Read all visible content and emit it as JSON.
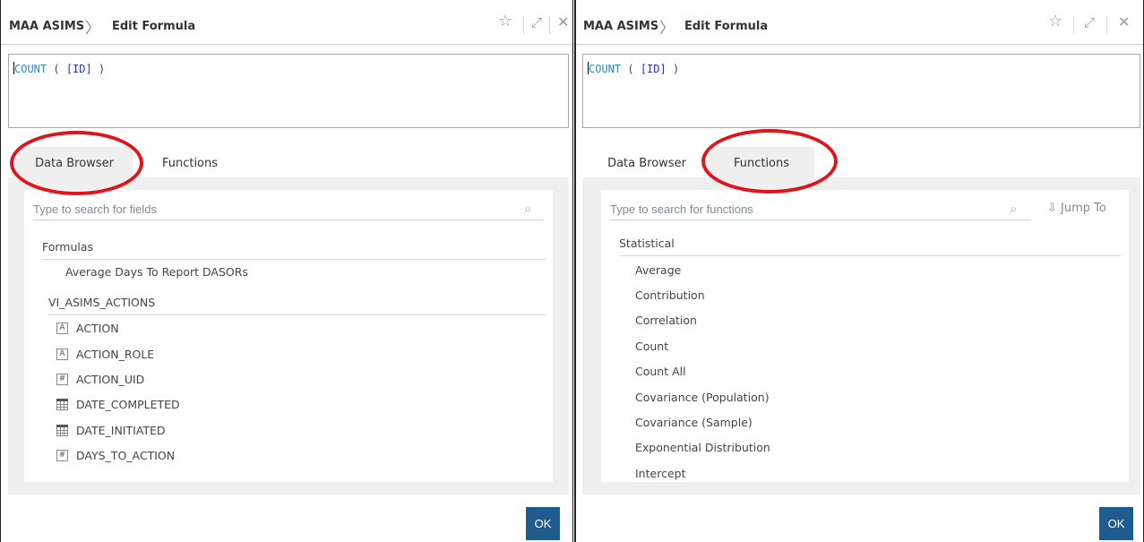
{
  "left_panel": {
    "breadcrumb": {
      "app": "MAA ASIMS",
      "separator": "〉",
      "page": "Edit Formula"
    },
    "icons": {
      "favorite": "☆",
      "expand": "⤢",
      "close": "✕"
    },
    "formula": {
      "function": "COUNT",
      "open": " ( ",
      "field": "[ID]",
      "close": " )"
    },
    "tabs": [
      {
        "label": "Data Browser",
        "active": true
      },
      {
        "label": "Functions",
        "active": false
      }
    ],
    "search": {
      "placeholder": "Type to search for fields"
    },
    "groups": [
      {
        "name": "Formulas",
        "items": [
          "Average Days To Report DASORs"
        ]
      },
      {
        "name": "VI_ASIMS_ACTIONS"
      }
    ],
    "fields": [
      {
        "type_icon": "text-type-icon",
        "type_glyph": "A",
        "label": "ACTION"
      },
      {
        "type_icon": "text-type-icon",
        "type_glyph": "A",
        "label": "ACTION_ROLE"
      },
      {
        "type_icon": "number-type-icon",
        "type_glyph": "#",
        "label": "ACTION_UID"
      },
      {
        "type_icon": "date-type-icon",
        "type_glyph": "",
        "label": "DATE_COMPLETED"
      },
      {
        "type_icon": "date-type-icon",
        "type_glyph": "",
        "label": "DATE_INITIATED"
      },
      {
        "type_icon": "number-type-icon",
        "type_glyph": "#",
        "label": "DAYS_TO_ACTION"
      }
    ],
    "ok_label": "OK"
  },
  "right_panel": {
    "breadcrumb": {
      "app": "MAA ASIMS",
      "separator": "〉",
      "page": "Edit Formula"
    },
    "icons": {
      "favorite": "☆",
      "expand": "⤢",
      "close": "✕"
    },
    "formula": {
      "function": "COUNT",
      "open": " ( ",
      "field": "[ID]",
      "close": " )"
    },
    "tabs": [
      {
        "label": "Data Browser",
        "active": false
      },
      {
        "label": "Functions",
        "active": true
      }
    ],
    "search": {
      "placeholder": "Type to search for functions"
    },
    "jump_to": {
      "icon": "⇩",
      "label": "Jump To"
    },
    "category": "Statistical",
    "functions": [
      "Average",
      "Contribution",
      "Correlation",
      "Count",
      "Count All",
      "Covariance (Population)",
      "Covariance (Sample)",
      "Exponential Distribution",
      "Intercept"
    ],
    "ok_label": "OK"
  },
  "colors": {
    "accent": "#1f5b8d",
    "highlight_annotation": "#e0141a",
    "formula_function": "#2a8bd0",
    "formula_field": "#2335c9"
  }
}
